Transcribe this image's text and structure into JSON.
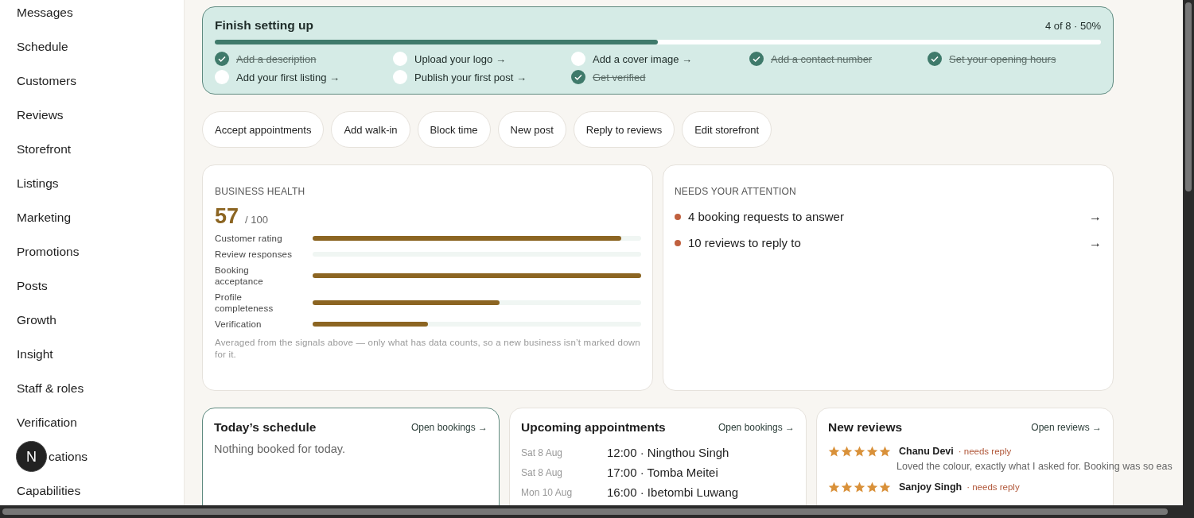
{
  "sidebar": {
    "items": [
      {
        "label": "Messages",
        "selected": false
      },
      {
        "label": "Schedule",
        "selected": false
      },
      {
        "label": "Customers",
        "selected": false
      },
      {
        "label": "Reviews",
        "selected": false
      },
      {
        "label": "Storefront",
        "selected": false
      },
      {
        "label": "Listings",
        "selected": false
      },
      {
        "label": "Marketing",
        "selected": false
      },
      {
        "label": "Promotions",
        "selected": false
      },
      {
        "label": "Posts",
        "selected": false
      },
      {
        "label": "Growth",
        "selected": false
      },
      {
        "label": "Insight",
        "selected": false
      },
      {
        "label": "Staff & roles",
        "selected": false
      },
      {
        "label": "Verification",
        "selected": false
      },
      {
        "label": "cations",
        "selected": false,
        "partly_hidden": true
      },
      {
        "label": "Capabilities",
        "selected": false
      }
    ],
    "badge": "N"
  },
  "setup": {
    "title": "Finish setting up",
    "progress_text": "4 of 8 · 50%",
    "level": 0.5,
    "tasks": [
      {
        "label": "Add a description",
        "checked": true
      },
      {
        "label": "Upload your logo →",
        "checked": false
      },
      {
        "label": "Add a cover image →",
        "checked": false
      },
      {
        "label": "Add a contact number",
        "checked": true
      },
      {
        "label": "Set your opening hours",
        "checked": true
      },
      {
        "label": "Add your first listing →",
        "checked": false
      },
      {
        "label": "Publish your first post →",
        "checked": false
      },
      {
        "label": "Get verified",
        "checked": true
      }
    ]
  },
  "quick_actions": [
    "Accept appointments",
    "Add walk-in",
    "Block time",
    "New post",
    "Reply to reviews",
    "Edit storefront"
  ],
  "health": {
    "heading": "BUSINESS HEALTH",
    "score": "57",
    "out_of": "/ 100",
    "signals": [
      {
        "label": "Customer rating",
        "level": 0.94
      },
      {
        "label": "Review responses",
        "level": 0
      },
      {
        "label": "Booking acceptance",
        "level": 1
      },
      {
        "label": "Profile completeness",
        "level": 0.57
      },
      {
        "label": "Verification",
        "level": 0.35
      }
    ],
    "note": "Averaged from the signals above — only what has data counts, so a new business isn’t marked down for it."
  },
  "attention": {
    "heading": "NEEDS YOUR ATTENTION",
    "items": [
      {
        "label": "4 booking requests to answer",
        "arrow": "→",
        "color": "#c0603e"
      },
      {
        "label": "10 reviews to reply to",
        "arrow": "→",
        "color": "#c0603e"
      }
    ]
  },
  "today": {
    "title": "Today’s schedule",
    "link": "Open bookings →",
    "highlighted": true,
    "empty": "Nothing booked for today."
  },
  "upcoming": {
    "title": "Upcoming appointments",
    "link": "Open bookings →",
    "highlighted": false,
    "rows": [
      {
        "date": "Sat 8 Aug",
        "detail": "12:00 · Ningthou Singh"
      },
      {
        "date": "Sat 8 Aug",
        "detail": "17:00 · Tomba Meitei"
      },
      {
        "date": "Mon 10 Aug",
        "detail": "16:00 · Ibetombi Luwang"
      }
    ]
  },
  "reviews": {
    "title": "New reviews",
    "link": "Open reviews →",
    "highlighted": false,
    "items": [
      {
        "stars": 5,
        "name": "Chanu Devi",
        "status": "· needs reply",
        "text": "Loved the colour, exactly what I asked for. Booking was so eas"
      },
      {
        "stars": 5,
        "name": "Sanjoy Singh",
        "status": "· needs reply"
      }
    ]
  }
}
